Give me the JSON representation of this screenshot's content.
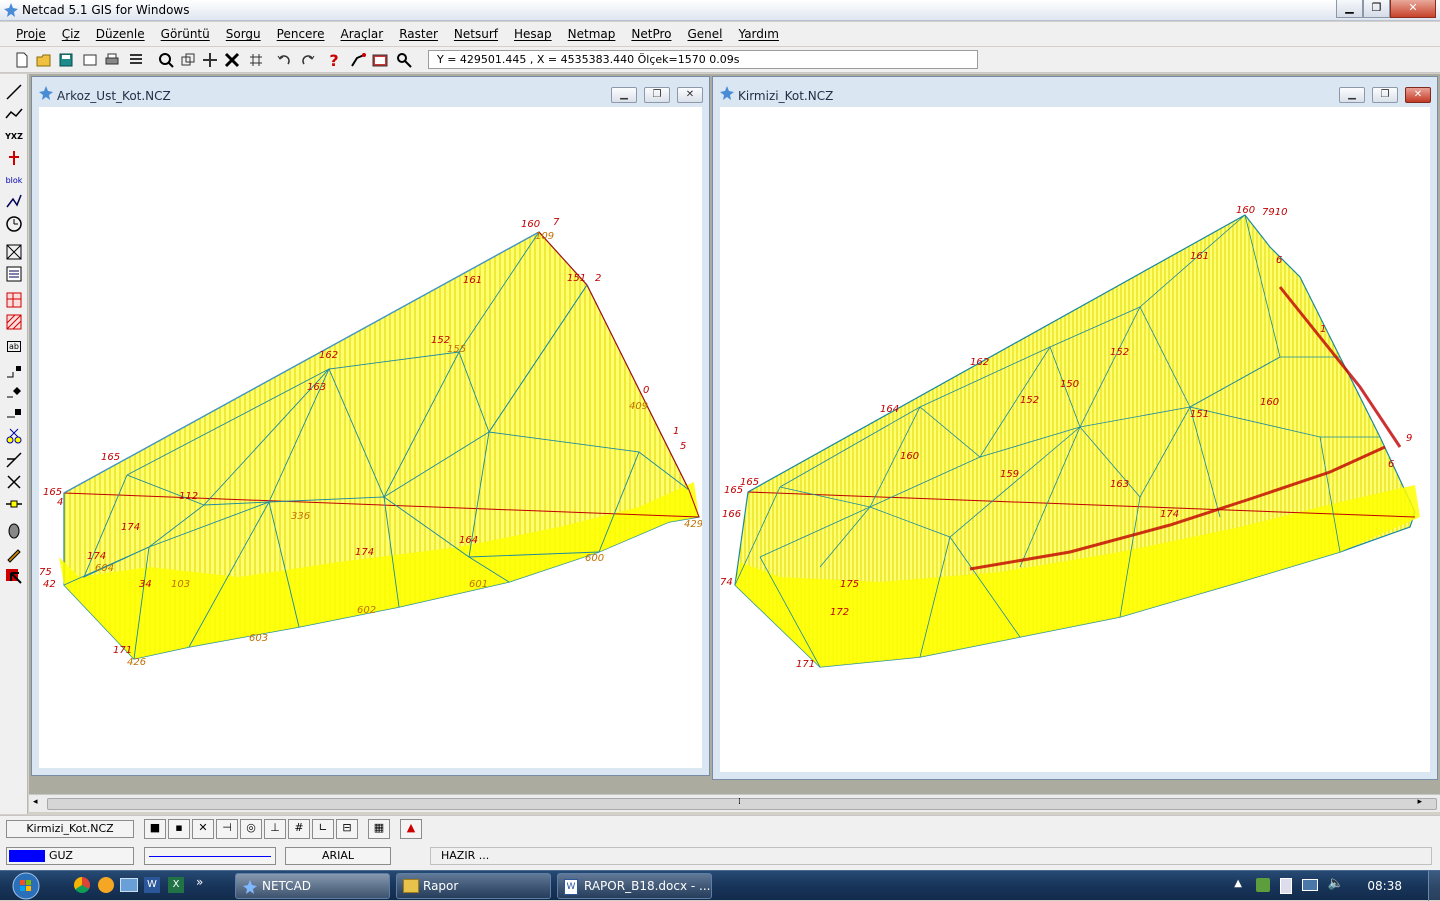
{
  "app": {
    "title": "Netcad 5.1 GIS for Windows"
  },
  "menu": [
    "Proje",
    "Çiz",
    "Düzenle",
    "Görüntü",
    "Sorgu",
    "Pencere",
    "Araçlar",
    "Raster",
    "Netsurf",
    "Hesap",
    "Netmap",
    "NetPro",
    "Genel",
    "Yardım"
  ],
  "coordinate_readout": "Y = 429501.445 , X = 4535383.440  Ölçek=1570   0.09s",
  "windows": {
    "left": {
      "title": "Arkoz_Ust_Kot.NCZ",
      "labels": [
        "160",
        "7",
        "109",
        "161",
        "151",
        "2",
        "162",
        "152",
        "163",
        "155",
        "0",
        "409",
        "1",
        "5",
        "165",
        "165",
        "174",
        "112",
        "336",
        "4",
        "429",
        "75",
        "42",
        "174",
        "604",
        "34",
        "103",
        "174",
        "164",
        "600",
        "601",
        "602",
        "603",
        "426",
        "171"
      ]
    },
    "right": {
      "title": "Kirmizi_Kot.NCZ",
      "labels": [
        "160",
        "7910",
        "161",
        "6",
        "162",
        "152",
        "1",
        "164",
        "160",
        "165",
        "165",
        "166",
        "150",
        "152",
        "151",
        "160",
        "163",
        "174",
        "159",
        "74",
        "171",
        "172",
        "175",
        "6",
        "9"
      ]
    }
  },
  "status": {
    "active_drawing": "Kirmizi_Kot.NCZ",
    "layer": "GUZ",
    "font": "ARIAL",
    "message": "HAZIR ..."
  },
  "taskbar": {
    "items": [
      "NETCAD",
      "Rapor",
      "RAPOR_B18.docx - ..."
    ],
    "clock": "08:38",
    "show_more": "»"
  },
  "colors": {
    "fill_yellow": "#ffff00",
    "edge_teal": "#1a8aa0",
    "label_red": "#c00000",
    "label_orange": "#c07000"
  }
}
